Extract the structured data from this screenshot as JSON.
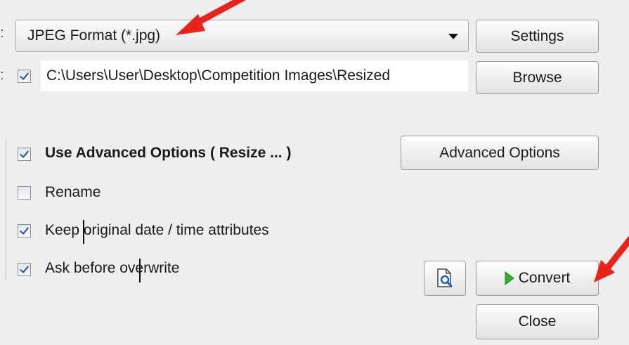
{
  "format_select": {
    "value": "JPEG Format (*.jpg)"
  },
  "buttons": {
    "settings": "Settings",
    "browse": "Browse",
    "advanced_options": "Advanced Options",
    "convert": "Convert",
    "close": "Close"
  },
  "output_folder": {
    "checked": true,
    "path": "C:\\Users\\User\\Desktop\\Competition Images\\Resized"
  },
  "options": [
    {
      "label": "Use Advanced Options ( Resize ... )",
      "checked": true
    },
    {
      "label": "Rename",
      "checked": false
    },
    {
      "label": "Keep original date / time attributes",
      "checked": true
    },
    {
      "label": "Ask before overwrite",
      "checked": true
    }
  ],
  "colors": {
    "annotation_arrow": "#e8231a",
    "convert_play": "#2bb52b",
    "preview_icon": "#1e5bd6"
  },
  "icons": {
    "preview": "document-magnifier-icon",
    "convert": "play-icon"
  }
}
